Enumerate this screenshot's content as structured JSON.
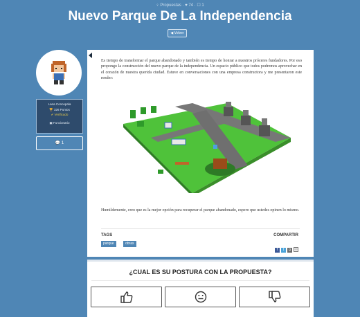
{
  "breadcrumb": "♀ Propuestas · ♥ 74 · ☐ 1",
  "title": "Nuevo Parque De La Independencia",
  "back_label": "◀ Volver",
  "profile": {
    "name": "Lana Concepala",
    "points": "326 Puntos",
    "verified": "Verificado",
    "role": "Funcionario"
  },
  "comments": {
    "count": "1"
  },
  "content": {
    "paragraph1": "Es tiempo de transformar el parque abandonado y también es tiempo de honrar a nuestros próceres fundadores. Por eso propongo la construcción del nuevo parque de la independencia. Un espacio público que todos podremos aprovechar en el corazón de nuestra querida ciudad. Estuve en conversaciones con una empresa constructora y me presentaron este render:",
    "paragraph2": "Humildemente, creo que es la mejor opción para recuperar el parque abandonado, espero que ustedes opinen lo mismo.",
    "tags_label": "TAGS",
    "tags": [
      "parque",
      "obras"
    ],
    "share_label": "COMPARTIR"
  },
  "vote": {
    "question": "¿CUAL ES SU POSTURA CON LA PROPUESTA?"
  },
  "colors": {
    "background": "#4f86b5",
    "grass": "#4fc23a",
    "path": "#6f6f6f"
  }
}
